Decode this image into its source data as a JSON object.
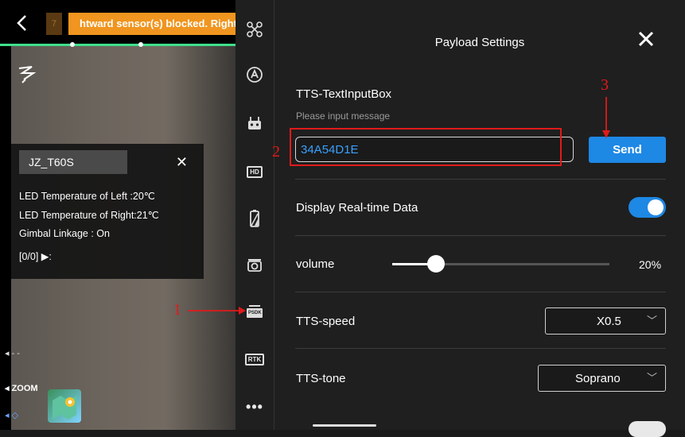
{
  "camera": {
    "back_icon": "chevron-left-icon",
    "badge": "7",
    "warning_text": "htward sensor(s) blocked. Right",
    "info_panel": {
      "title": "JZ_T60S",
      "lines": [
        "LED Temperature of  Left :20℃",
        "LED Temperature of Right:21℃",
        "Gimbal Linkage : On",
        "[0/0] ▶:"
      ]
    },
    "dashes": "◂ - -",
    "zoom_label": "◂ ZOOM",
    "marker": "◂ ◇"
  },
  "toolbar": {
    "items": [
      "drone-icon",
      "altitude-icon",
      "remote-controller-icon",
      "HD",
      "battery-icon",
      "camera-icon",
      "PSDK",
      "RTK",
      "more-icon"
    ]
  },
  "panel": {
    "title": "Payload Settings",
    "tts_label": "TTS-TextInputBox",
    "tts_hint": "Please input message",
    "tts_value": "34A54D1E",
    "send_label": "Send",
    "realtime_label": "Display Real-time Data",
    "realtime_on": true,
    "volume_label": "volume",
    "volume_value": "20%",
    "volume_fraction": 0.2,
    "speed_label": "TTS-speed",
    "speed_value": "X0.5",
    "tone_label": "TTS-tone",
    "tone_value": "Soprano"
  },
  "annotations": {
    "one": "1",
    "two": "2",
    "three": "3"
  },
  "colors": {
    "warning": "#f0951f",
    "accent": "#1e88e5",
    "annotation": "#e01a1a",
    "status_line": "#3fe08c"
  }
}
